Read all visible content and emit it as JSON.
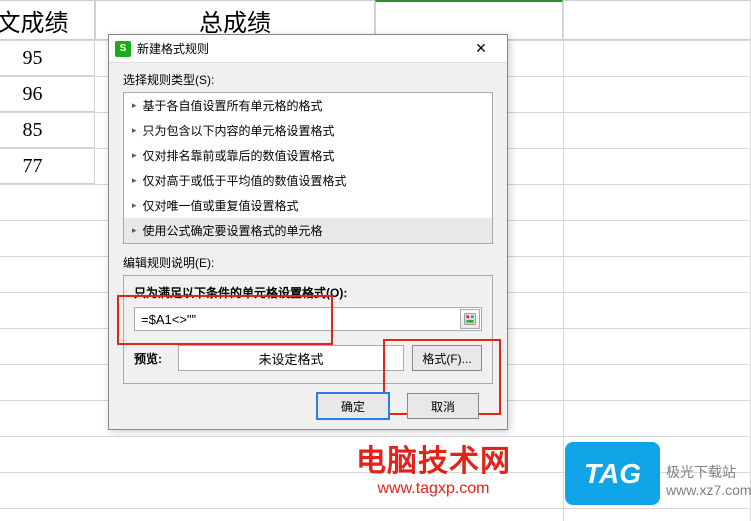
{
  "sheet": {
    "headers": [
      "文成绩",
      "总成绩"
    ],
    "col1": [
      "95",
      "96",
      "85",
      "77"
    ]
  },
  "dialog": {
    "title": "新建格式规则",
    "select_rule_type_label": "选择规则类型(S):",
    "rule_types": [
      "基于各自值设置所有单元格的格式",
      "只为包含以下内容的单元格设置格式",
      "仅对排名靠前或靠后的数值设置格式",
      "仅对高于或低于平均值的数值设置格式",
      "仅对唯一值或重复值设置格式",
      "使用公式确定要设置格式的单元格"
    ],
    "edit_rule_label": "编辑规则说明(E):",
    "condition_label": "只为满足以下条件的单元格设置格式(O):",
    "formula_value": "=$A1<>\"\"",
    "preview_label": "预览:",
    "preview_text": "未设定格式",
    "format_btn": "格式(F)...",
    "ok_btn": "确定",
    "cancel_btn": "取消"
  },
  "watermarks": {
    "w1_big": "电脑技术网",
    "w1_small": "www.tagxp.com",
    "tag": "TAG",
    "w2": "极光下载站",
    "w2_small": "www.xz7.com"
  }
}
